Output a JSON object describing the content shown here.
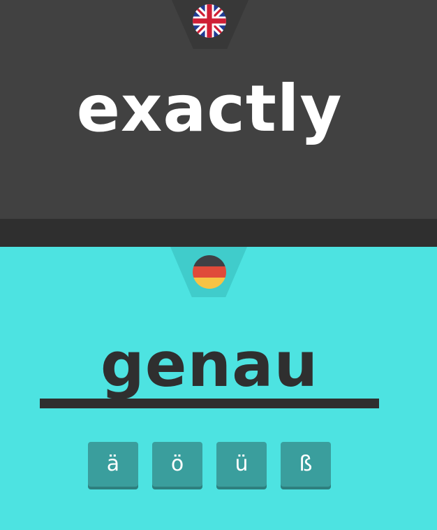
{
  "source": {
    "language_icon": "uk-flag-icon",
    "word": "exactly"
  },
  "target": {
    "language_icon": "germany-flag-icon",
    "answer": "genau"
  },
  "special_characters": [
    "ä",
    "ö",
    "ü",
    "ß"
  ],
  "colors": {
    "top_background": "#414141",
    "band": "#2f2f2f",
    "bottom_background": "#4de3e1",
    "key_background": "#3a9e9d",
    "text_dark": "#2f2f2f",
    "text_light": "#ffffff"
  }
}
